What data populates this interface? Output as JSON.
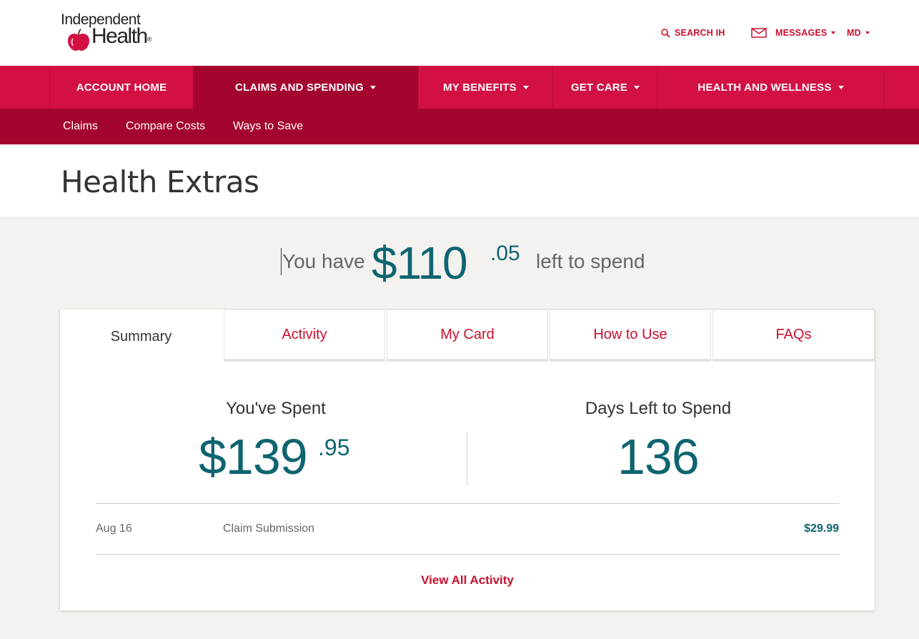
{
  "brand": {
    "line1": "Independent",
    "line2": "Health",
    "reg": "®",
    "primary_color": "#c8102e",
    "nav_color": "#d31044",
    "nav_dark_color": "#a4052e",
    "accent_teal": "#0e6470"
  },
  "utility": {
    "search_label": "SEARCH IH",
    "messages_label": "MESSAGES",
    "user_label": "MD",
    "icons": [
      "search-icon",
      "envelope-icon"
    ]
  },
  "main_nav": [
    {
      "label": "ACCOUNT HOME",
      "has_caret": false,
      "active": false
    },
    {
      "label": "CLAIMS AND SPENDING",
      "has_caret": true,
      "active": true
    },
    {
      "label": "MY BENEFITS",
      "has_caret": true,
      "active": false
    },
    {
      "label": "GET CARE",
      "has_caret": true,
      "active": false
    },
    {
      "label": "HEALTH AND WELLNESS",
      "has_caret": true,
      "active": false
    }
  ],
  "sub_nav": [
    "Claims",
    "Compare Costs",
    "Ways to Save"
  ],
  "page": {
    "title": "Health Extras"
  },
  "balance": {
    "prefix": "You have",
    "dollars": "$110",
    "cents": ".05",
    "suffix": "left to spend"
  },
  "tabs": [
    {
      "label": "Summary",
      "active": true
    },
    {
      "label": "Activity",
      "active": false
    },
    {
      "label": "My Card",
      "active": false
    },
    {
      "label": "How to Use",
      "active": false
    },
    {
      "label": "FAQs",
      "active": false
    }
  ],
  "summary": {
    "spent_title": "You've Spent",
    "spent_dollars": "$139",
    "spent_cents": ".95",
    "days_title": "Days Left to Spend",
    "days_value": "136"
  },
  "activity": [
    {
      "date": "Aug 16",
      "description": "Claim Submission",
      "amount": "$29.99"
    }
  ],
  "view_all_label": "View All Activity"
}
